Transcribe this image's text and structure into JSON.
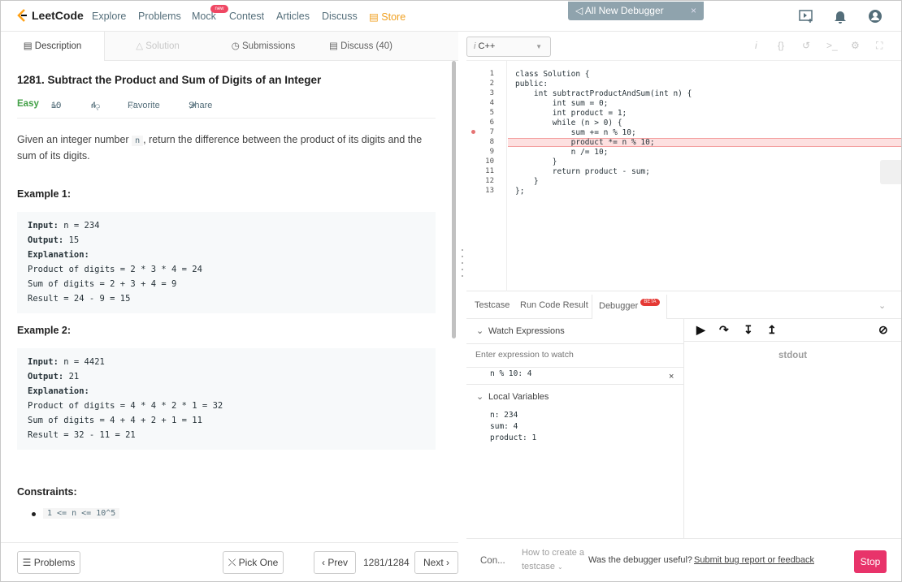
{
  "nav": {
    "logo_text": "LeetCode",
    "items": [
      "Explore",
      "Problems",
      "Mock",
      "Contest",
      "Articles",
      "Discuss"
    ],
    "store": "Store",
    "new_badge": "new",
    "debugger_banner": "All New Debugger"
  },
  "left_tabs": [
    "Description",
    "Solution",
    "Submissions",
    "Discuss (40)"
  ],
  "problem": {
    "title": "1281. Subtract the Product and Sum of Digits of an Integer",
    "difficulty": "Easy",
    "likes": "10",
    "dislikes": "4",
    "favorite": "Favorite",
    "share": "Share",
    "desc_prefix": "Given an integer number",
    "desc_var": "n",
    "desc_suffix": ", return the difference between the product of its digits and the sum of its digits.",
    "example1_title": "Example 1:",
    "example1": [
      {
        "label": "Input:",
        "text": " n = 234"
      },
      {
        "label": "Output:",
        "text": " 15"
      },
      {
        "label": "Explanation:",
        "text": ""
      },
      {
        "label": "",
        "text": "Product of digits = 2 * 3 * 4 = 24"
      },
      {
        "label": "",
        "text": "Sum of digits = 2 + 3 + 4 = 9"
      },
      {
        "label": "",
        "text": "Result = 24 - 9 = 15"
      }
    ],
    "example2_title": "Example 2:",
    "example2": [
      {
        "label": "Input:",
        "text": " n = 4421"
      },
      {
        "label": "Output:",
        "text": " 21"
      },
      {
        "label": "Explanation:",
        "text": ""
      },
      {
        "label": "",
        "text": "Product of digits = 4 * 4 * 2 * 1 = 32"
      },
      {
        "label": "",
        "text": "Sum of digits = 4 + 4 + 2 + 1 = 11"
      },
      {
        "label": "",
        "text": "Result = 32 - 11 = 21"
      }
    ],
    "constraints_title": "Constraints:",
    "constraint": "1 <= n <= 10^5"
  },
  "bottom_left": {
    "problems": "Problems",
    "pick_one": "Pick One",
    "prev": "Prev",
    "counter": "1281/1284",
    "next": "Next"
  },
  "editor": {
    "language": "C++",
    "line_numbers": [
      "1",
      "2",
      "3",
      "4",
      "5",
      "6",
      "7",
      "8",
      "9",
      "10",
      "11",
      "12",
      "13"
    ],
    "lines": [
      "class Solution {",
      "public:",
      "    int subtractProductAndSum(int n) {",
      "        int sum = 0;",
      "        int product = 1;",
      "        while (n > 0) {",
      "            sum += n % 10;",
      "            product *= n % 10;",
      "            n /= 10;",
      "        }",
      "        return product - sum;",
      "    }",
      "};"
    ]
  },
  "debug_tabs": [
    "Testcase",
    "Run Code Result",
    "Debugger"
  ],
  "beta": "BETA",
  "watch": {
    "title": "Watch Expressions",
    "placeholder": "Enter expression to watch",
    "expression": "n % 10: 4"
  },
  "locals": {
    "title": "Local Variables",
    "vars": [
      "n: 234",
      "sum: 4",
      "product: 1"
    ]
  },
  "stdout": "stdout",
  "bottom_right": {
    "con": "Con...",
    "howto_line1": "How to create a",
    "howto_line2": "testcase",
    "feedback_q": "Was the debugger useful?",
    "feedback_link": "Submit bug report or feedback",
    "stop": "Stop"
  }
}
